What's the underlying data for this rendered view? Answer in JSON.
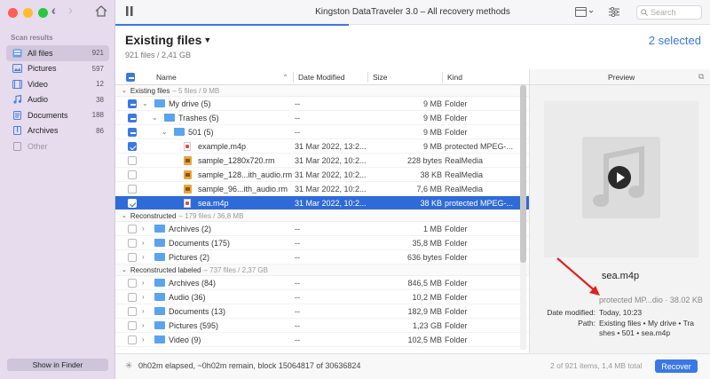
{
  "window": {
    "title": "Kingston DataTraveler 3.0 – All recovery methods"
  },
  "search": {
    "placeholder": "Search"
  },
  "sidebar": {
    "header": "Scan results",
    "items": [
      {
        "label": "All files",
        "count": "921",
        "icon": "files-icon"
      },
      {
        "label": "Pictures",
        "count": "597",
        "icon": "picture-icon"
      },
      {
        "label": "Video",
        "count": "12",
        "icon": "video-icon"
      },
      {
        "label": "Audio",
        "count": "38",
        "icon": "music-note-icon"
      },
      {
        "label": "Documents",
        "count": "188",
        "icon": "document-icon"
      },
      {
        "label": "Archives",
        "count": "86",
        "icon": "archive-icon"
      },
      {
        "label": "Other",
        "count": "",
        "icon": "other-icon"
      }
    ],
    "show_in_finder": "Show in Finder"
  },
  "header": {
    "title": "Existing files",
    "subtitle": "921 files / 2,41 GB",
    "selected": "2 selected"
  },
  "table": {
    "columns": {
      "name": "Name",
      "date": "Date Modified",
      "size": "Size",
      "kind": "Kind"
    },
    "groups": [
      {
        "label": "Existing files",
        "meta": "– 5 files / 9 MB",
        "rows": [
          {
            "name": "My drive (5)",
            "date": "--",
            "size": "9 MB",
            "kind": "Folder",
            "indent": 0,
            "check": "mixed",
            "disc": "open",
            "icon": "folder"
          },
          {
            "name": "Trashes (5)",
            "date": "--",
            "size": "9 MB",
            "kind": "Folder",
            "indent": 1,
            "check": "mixed",
            "disc": "open",
            "icon": "folder"
          },
          {
            "name": "501 (5)",
            "date": "--",
            "size": "9 MB",
            "kind": "Folder",
            "indent": 2,
            "check": "mixed",
            "disc": "open",
            "icon": "folder"
          },
          {
            "name": "example.m4p",
            "date": "31 Mar 2022, 13:2...",
            "size": "9 MB",
            "kind": "protected MPEG-...",
            "indent": 3,
            "check": "checked",
            "disc": "",
            "icon": "m4p"
          },
          {
            "name": "sample_1280x720.rm",
            "date": "31 Mar 2022, 10:2...",
            "size": "228 bytes",
            "kind": "RealMedia",
            "indent": 3,
            "check": "none",
            "disc": "",
            "icon": "rm"
          },
          {
            "name": "sample_128...ith_audio.rm",
            "date": "31 Mar 2022, 10:2...",
            "size": "38 KB",
            "kind": "RealMedia",
            "indent": 3,
            "check": "none",
            "disc": "",
            "icon": "rm"
          },
          {
            "name": "sample_96...ith_audio.rm",
            "date": "31 Mar 2022, 10:2...",
            "size": "7,6 MB",
            "kind": "RealMedia",
            "indent": 3,
            "check": "none",
            "disc": "",
            "icon": "rm"
          },
          {
            "name": "sea.m4p",
            "date": "31 Mar 2022, 10:2...",
            "size": "38 KB",
            "kind": "protected MPEG-...",
            "indent": 3,
            "check": "checked",
            "disc": "",
            "icon": "m4p",
            "selected": true
          }
        ]
      },
      {
        "label": "Reconstructed",
        "meta": "– 179 files / 36,8 MB",
        "rows": [
          {
            "name": "Archives (2)",
            "date": "--",
            "size": "1 MB",
            "kind": "Folder",
            "indent": 0,
            "check": "none",
            "disc": "closed",
            "icon": "folder"
          },
          {
            "name": "Documents (175)",
            "date": "--",
            "size": "35,8 MB",
            "kind": "Folder",
            "indent": 0,
            "check": "none",
            "disc": "closed",
            "icon": "folder"
          },
          {
            "name": "Pictures (2)",
            "date": "--",
            "size": "636 bytes",
            "kind": "Folder",
            "indent": 0,
            "check": "none",
            "disc": "closed",
            "icon": "folder"
          }
        ]
      },
      {
        "label": "Reconstructed labeled",
        "meta": "– 737 files / 2,37 GB",
        "rows": [
          {
            "name": "Archives (84)",
            "date": "--",
            "size": "846,5 MB",
            "kind": "Folder",
            "indent": 0,
            "check": "none",
            "disc": "closed",
            "icon": "folder"
          },
          {
            "name": "Audio (36)",
            "date": "--",
            "size": "10,2 MB",
            "kind": "Folder",
            "indent": 0,
            "check": "none",
            "disc": "closed",
            "icon": "folder"
          },
          {
            "name": "Documents (13)",
            "date": "--",
            "size": "182,9 MB",
            "kind": "Folder",
            "indent": 0,
            "check": "none",
            "disc": "closed",
            "icon": "folder"
          },
          {
            "name": "Pictures (595)",
            "date": "--",
            "size": "1,23 GB",
            "kind": "Folder",
            "indent": 0,
            "check": "none",
            "disc": "closed",
            "icon": "folder"
          },
          {
            "name": "Video (9)",
            "date": "--",
            "size": "102,5 MB",
            "kind": "Folder",
            "indent": 0,
            "check": "none",
            "disc": "closed",
            "icon": "folder"
          }
        ]
      }
    ]
  },
  "preview": {
    "header": "Preview",
    "file_name": "sea.m4p",
    "type_size": "protected MP...dio · 38.02 KB",
    "date_label": "Date modified:",
    "date_value": "Today, 10:23",
    "path_label": "Path:",
    "path_line1": "Existing files • My drive • Tra",
    "path_line2": "shes • 501 • sea.m4p"
  },
  "footer": {
    "status": "0h02m elapsed, ~0h02m remain, block 15064817 of 30636824",
    "items": "2 of 921 items, 1,4 MB total",
    "recover": "Recover"
  },
  "colors": {
    "accent": "#3a78e5",
    "sidebar_bg": "#e6dcee",
    "selected_row": "#2f6bd8",
    "annotation_arrow": "#e0211d"
  }
}
